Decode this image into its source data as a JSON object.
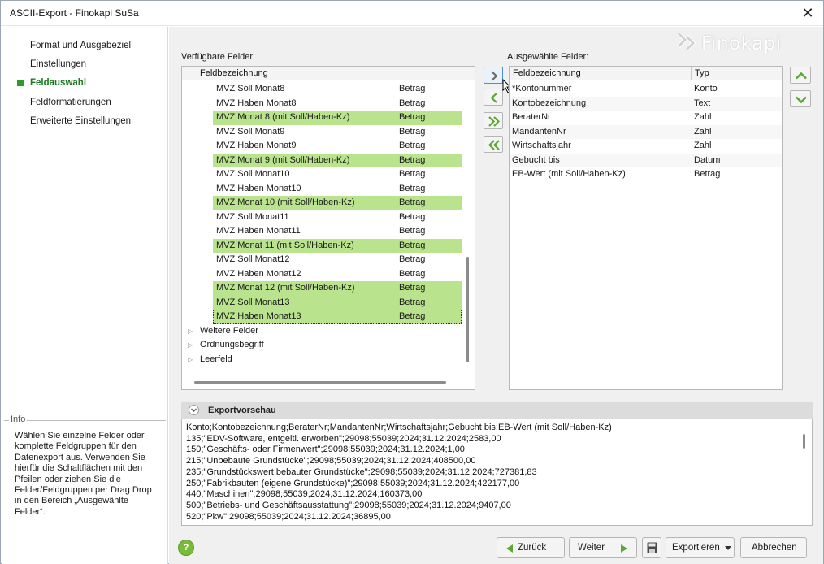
{
  "window": {
    "title": "ASCII-Export - Finokapi SuSa",
    "close_glyph": "✕"
  },
  "logo": {
    "text": "Finokapi"
  },
  "sidebar": {
    "items": [
      {
        "label": "Format und Ausgabeziel"
      },
      {
        "label": "Einstellungen"
      },
      {
        "label": "Feldauswahl"
      },
      {
        "label": "Feldformatierungen"
      },
      {
        "label": "Erweiterte Einstellungen"
      }
    ],
    "active_index": 2
  },
  "info": {
    "legend": "Info",
    "text": "Wählen Sie einzelne Felder oder komplette Feldgruppen für den Datenexport aus. Verwenden Sie hierfür die Schaltflächen mit den Pfeilen oder ziehen Sie die Felder/Feldgruppen per Drag Drop in den Bereich „Ausgewählte Felder“."
  },
  "available": {
    "label": "Verfügbare Felder:",
    "header": "Feldbezeichnung",
    "rows": [
      {
        "name": "MVZ Soll Monat8",
        "type": "Betrag",
        "hl": false
      },
      {
        "name": "MVZ Haben Monat8",
        "type": "Betrag",
        "hl": false
      },
      {
        "name": "MVZ Monat 8 (mit Soll/Haben-Kz)",
        "type": "Betrag",
        "hl": true
      },
      {
        "name": "MVZ Soll Monat9",
        "type": "Betrag",
        "hl": false
      },
      {
        "name": "MVZ Haben Monat9",
        "type": "Betrag",
        "hl": false
      },
      {
        "name": "MVZ Monat 9 (mit Soll/Haben-Kz)",
        "type": "Betrag",
        "hl": true
      },
      {
        "name": "MVZ Soll Monat10",
        "type": "Betrag",
        "hl": false
      },
      {
        "name": "MVZ Haben Monat10",
        "type": "Betrag",
        "hl": false
      },
      {
        "name": "MVZ Monat 10 (mit Soll/Haben-Kz)",
        "type": "Betrag",
        "hl": true
      },
      {
        "name": "MVZ Soll Monat11",
        "type": "Betrag",
        "hl": false
      },
      {
        "name": "MVZ Haben Monat11",
        "type": "Betrag",
        "hl": false
      },
      {
        "name": "MVZ Monat 11 (mit Soll/Haben-Kz)",
        "type": "Betrag",
        "hl": true
      },
      {
        "name": "MVZ Soll Monat12",
        "type": "Betrag",
        "hl": false
      },
      {
        "name": "MVZ Haben Monat12",
        "type": "Betrag",
        "hl": false
      },
      {
        "name": "MVZ Monat 12 (mit Soll/Haben-Kz)",
        "type": "Betrag",
        "hl": true
      },
      {
        "name": "MVZ Soll Monat13",
        "type": "Betrag",
        "hl": true
      },
      {
        "name": "MVZ Haben Monat13",
        "type": "Betrag",
        "hl": true,
        "selected": true
      }
    ],
    "groups": [
      "Weitere Felder",
      "Ordnungsbegriff",
      "Leerfeld"
    ]
  },
  "selected": {
    "label": "Ausgewählte Felder:",
    "header_name": "Feldbezeichnung",
    "header_type": "Typ",
    "rows": [
      {
        "name": "*Kontonummer",
        "type": "Konto"
      },
      {
        "name": "Kontobezeichnung",
        "type": "Text"
      },
      {
        "name": "BeraterNr",
        "type": "Zahl"
      },
      {
        "name": "MandantenNr",
        "type": "Zahl"
      },
      {
        "name": "Wirtschaftsjahr",
        "type": "Zahl"
      },
      {
        "name": "Gebucht bis",
        "type": "Datum"
      },
      {
        "name": "EB-Wert (mit Soll/Haben-Kz)",
        "type": "Betrag"
      }
    ]
  },
  "preview": {
    "title": "Exportvorschau",
    "lines": [
      "Konto;Kontobezeichnung;BeraterNr;MandantenNr;Wirtschaftsjahr;Gebucht bis;EB-Wert (mit Soll/Haben-Kz)",
      "135;\"EDV-Software, entgeltl. erworben\";29098;55039;2024;31.12.2024;2583,00",
      "150;\"Geschäfts- oder Firmenwert\";29098;55039;2024;31.12.2024;1,00",
      "215;\"Unbebaute Grundstücke\";29098;55039;2024;31.12.2024;408500,00",
      "235;\"Grundstückswert bebauter Grundstücke\";29098;55039;2024;31.12.2024;727381,83",
      "250;\"Fabrikbauten (eigene Grundstücke)\";29098;55039;2024;31.12.2024;422177,00",
      "440;\"Maschinen\";29098;55039;2024;31.12.2024;160373,00",
      "500;\"Betriebs- und Geschäftsausstattung\";29098;55039;2024;31.12.2024;9407,00",
      "520;\"Pkw\";29098;55039;2024;31.12.2024;36895,00"
    ]
  },
  "buttons": {
    "help": "?",
    "back": "Zurück",
    "next": "Weiter",
    "export": "Exportieren",
    "cancel": "Abbrechen"
  },
  "colors": {
    "accent_green": "#2e9a2e",
    "row_highlight": "#b9e38c",
    "focus_blue": "#4a8fd6"
  },
  "icons": [
    "close-icon",
    "arrow-right-icon",
    "arrow-left-icon",
    "double-arrow-right-icon",
    "double-arrow-left-icon",
    "arrow-up-icon",
    "arrow-down-icon",
    "chevron-down-icon",
    "expand-triangle-icon",
    "help-icon",
    "save-icon",
    "triangle-left-icon",
    "triangle-right-icon",
    "dropdown-arrow-icon"
  ]
}
